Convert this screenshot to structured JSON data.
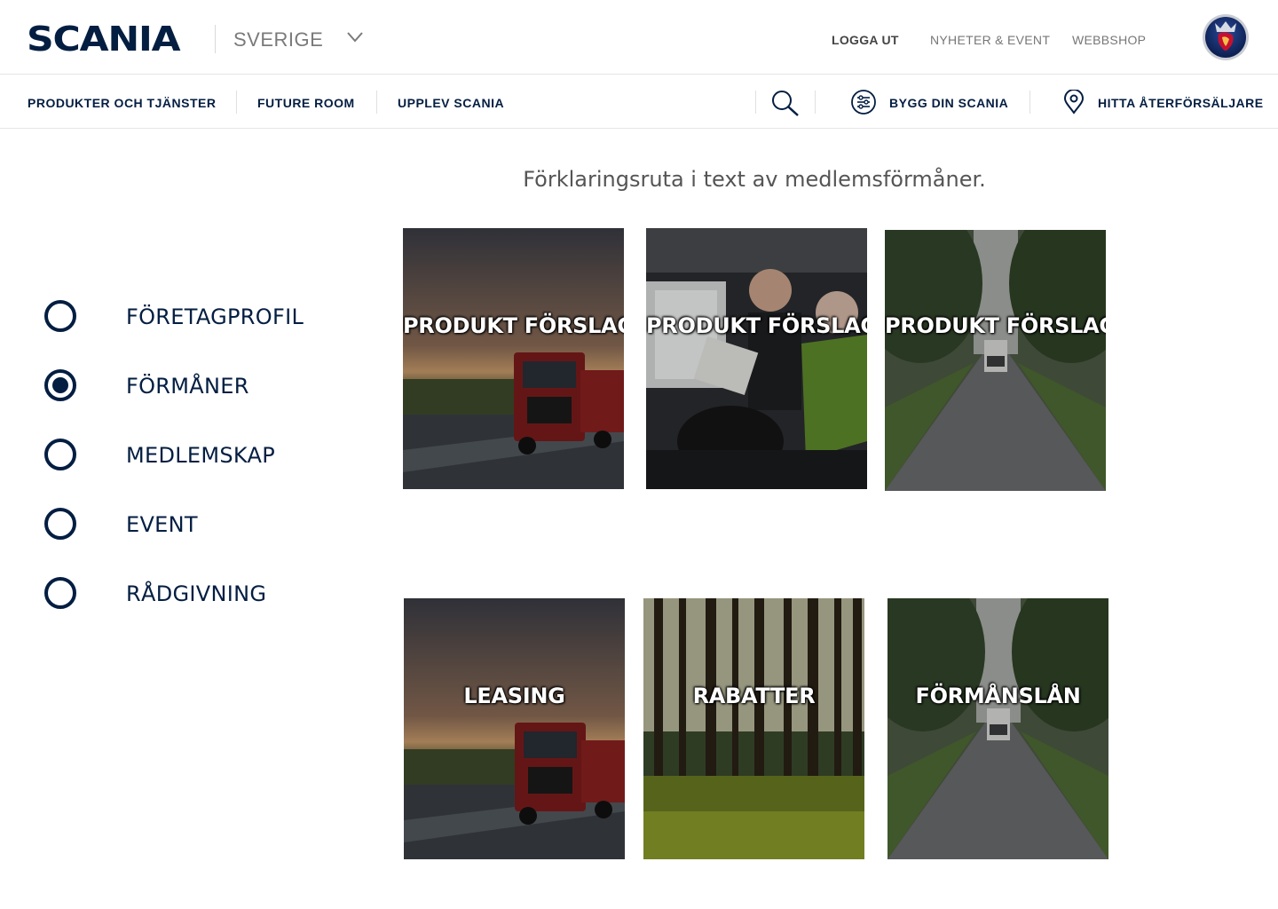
{
  "header": {
    "logo": "SCANIA",
    "country": "SVERIGE",
    "links": {
      "logout": "LOGGA UT",
      "news": "NYHETER & EVENT",
      "shop": "WEBBSHOP"
    }
  },
  "nav": {
    "items": [
      "PRODUKTER OCH TJÄNSTER",
      "FUTURE ROOM",
      "UPPLEV SCANIA"
    ],
    "build": "BYGG DIN SCANIA",
    "dealer": "HITTA ÅTERFÖRSÄLJARE"
  },
  "intro": "Förklaringsruta i text av medlemsförmåner.",
  "sidebar": {
    "selected": "FÖRMÅNER",
    "items": [
      {
        "label": "FÖRETAGPROFIL",
        "checked": false
      },
      {
        "label": "FÖRMÅNER",
        "checked": true
      },
      {
        "label": "MEDLEMSKAP",
        "checked": false
      },
      {
        "label": "EVENT",
        "checked": false
      },
      {
        "label": "RÅDGIVNING",
        "checked": false
      }
    ]
  },
  "tiles": [
    {
      "label": "PRODUKT FÖRSLAG",
      "image": "sunset-red-truck"
    },
    {
      "label": "PRODUKT FÖRSLAG",
      "image": "truck-cab-interior"
    },
    {
      "label": "PRODUKT FÖRSLAG",
      "image": "tree-lined-road-truck"
    },
    {
      "label": "LEASING",
      "image": "sunset-red-truck"
    },
    {
      "label": "RABATTER",
      "image": "pine-forest"
    },
    {
      "label": "FÖRMÅNSLÅN",
      "image": "tree-lined-road-truck"
    }
  ],
  "colors": {
    "brand": "#041e42",
    "muted": "#777777",
    "divider": "#e6e6e6"
  }
}
